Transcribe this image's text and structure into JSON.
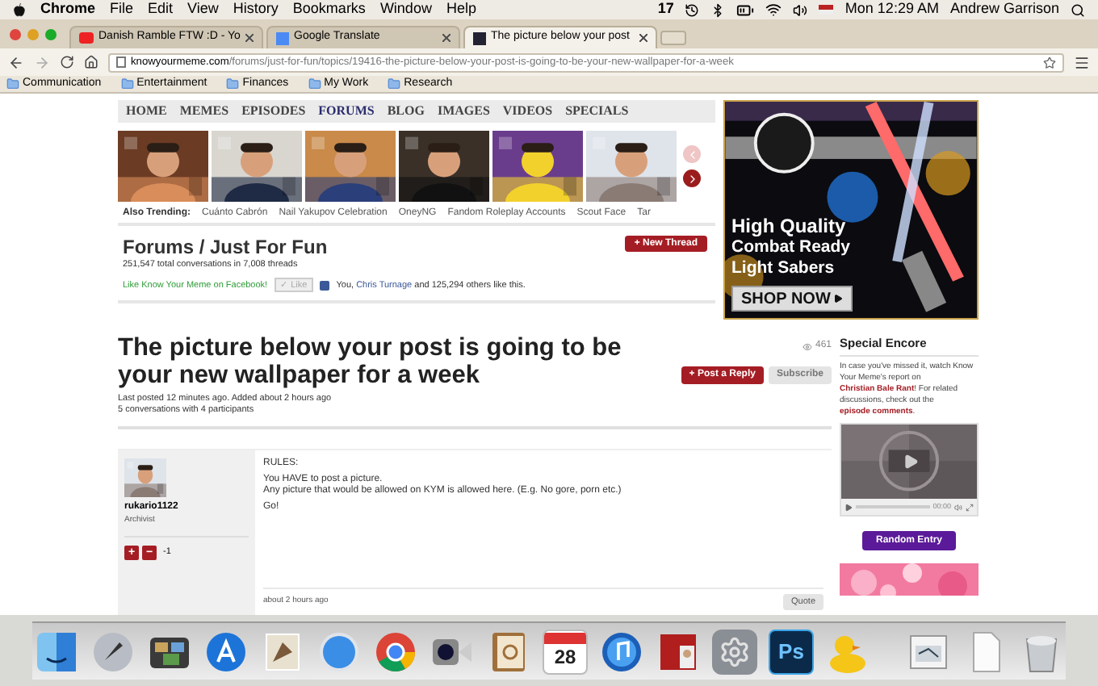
{
  "menu_bar": {
    "app": "Chrome",
    "menus": [
      "File",
      "Edit",
      "View",
      "History",
      "Bookmarks",
      "Window",
      "Help"
    ],
    "badge_count": "17",
    "clock": "Mon 12:29 AM",
    "user": "Andrew Garrison"
  },
  "tabs": [
    {
      "kind": "video",
      "title": "Danish Ramble FTW :D - Yo",
      "selected": false
    },
    {
      "kind": "translate",
      "title": "Google Translate",
      "selected": false
    },
    {
      "kind": "site",
      "title": "The picture below your post",
      "selected": true
    }
  ],
  "address_bar": {
    "domain": "knowyourmeme.com",
    "path": "/forums/just-for-fun/topics/19416-the-picture-below-your-post-is-going-to-be-your-new-wallpaper-for-a-week"
  },
  "bookmarks": [
    "Communication",
    "Entertainment",
    "Finances",
    "My Work",
    "Research"
  ],
  "site_nav": [
    {
      "label": "HOME",
      "selected": false
    },
    {
      "label": "MEMES",
      "selected": false
    },
    {
      "label": "EPISODES",
      "selected": false
    },
    {
      "label": "FORUMS",
      "selected": true
    },
    {
      "label": "BLOG",
      "selected": false
    },
    {
      "label": "IMAGES",
      "selected": false
    },
    {
      "label": "VIDEOS",
      "selected": false
    },
    {
      "label": "SPECIALS",
      "selected": false
    }
  ],
  "thumbnails": [
    {
      "kind": "picture"
    },
    {
      "kind": "picture"
    },
    {
      "kind": "picture"
    },
    {
      "kind": "picture"
    },
    {
      "kind": "picture"
    },
    {
      "kind": "picture"
    }
  ],
  "trending": {
    "label": "Also Trending:",
    "items": [
      "Cuánto Cabrón",
      "Nail Yakupov Celebration",
      "OneyNG",
      "Fandom Roleplay Accounts",
      "Scout Face",
      "Tar"
    ]
  },
  "forum_header": {
    "title": "Forums / Just For Fun",
    "stats": "251,547 total conversations in 7,008 threads",
    "new_thread": "+ New Thread",
    "facebook": {
      "prompt": "Like Know Your Meme on Facebook!",
      "like": "✓ Like",
      "before": "You, ",
      "friend": "Chris Turnage",
      "after": " and 125,294 others like this."
    }
  },
  "ad": {
    "lines": [
      "High Quality",
      "Combat Ready",
      "Light Sabers"
    ],
    "cta": "SHOP NOW"
  },
  "thread": {
    "title": "The picture below your post is going to be your new wallpaper for a week",
    "views": "461",
    "reply": "+ Post a Reply",
    "subscribe": "Subscribe",
    "meta": [
      "Last posted 12 minutes ago. Added about 2 hours ago",
      "5 conversations with 4 participants"
    ]
  },
  "post": {
    "author": "rukario1122",
    "role": "Archivist",
    "vote_up": "+",
    "vote_down": "−",
    "score": "-1",
    "lines": [
      "RULES:",
      "You HAVE to post a picture.",
      "Any picture that would be allowed on KYM is allowed here. (E.g. No gore, porn etc.)",
      "Go!"
    ],
    "time": "about 2 hours ago",
    "quote": "Quote"
  },
  "sidebar": {
    "title": "Special Encore",
    "text": [
      {
        "text": "In case you've missed it, watch Know Your Meme's report on ",
        "link": false
      },
      {
        "text": "Christian Bale Rant",
        "link": true
      },
      {
        "text": "! For related discussions, check out the ",
        "link": false
      },
      {
        "text": "episode comments",
        "link": true
      },
      {
        "text": ".",
        "link": false
      }
    ],
    "video_time": "00:00",
    "random": "Random Entry"
  },
  "dock": [
    {
      "kind": "finder"
    },
    {
      "kind": "launcher"
    },
    {
      "kind": "photos"
    },
    {
      "kind": "appstore"
    },
    {
      "kind": "mail"
    },
    {
      "kind": "safari"
    },
    {
      "kind": "chrome"
    },
    {
      "kind": "camera"
    },
    {
      "kind": "contacts"
    },
    {
      "kind": "calendar",
      "label": "28"
    },
    {
      "kind": "music"
    },
    {
      "kind": "photobooth"
    },
    {
      "kind": "settings"
    },
    {
      "kind": "photoshop",
      "label": "Ps"
    },
    {
      "kind": "duck"
    },
    {
      "kind": "separator"
    },
    {
      "kind": "preview"
    },
    {
      "kind": "document"
    },
    {
      "kind": "trash"
    }
  ]
}
